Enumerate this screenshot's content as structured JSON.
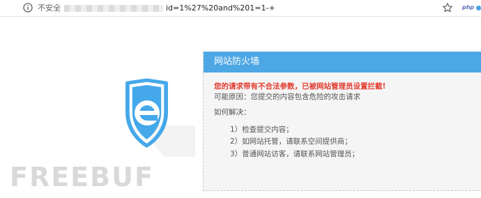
{
  "browser": {
    "security_label": "不安全",
    "url_visible": "id=1%27%20and%201=1-+",
    "extension_label": "php"
  },
  "panel": {
    "title": "网站防火墙",
    "warning": "您的请求带有不合法参数，已被网站管理员设置拦截!",
    "reason": "可能原因：您提交的内容包含危险的攻击请求",
    "howto": "如何解决：",
    "steps": [
      "1）检查提交内容；",
      "2）如网站托管，请联系空间提供商；",
      "3）普通网站访客，请联系网站管理员；"
    ]
  },
  "watermark": {
    "text": "FREEBUF"
  },
  "colors": {
    "header": "#4ea7e5",
    "warning": "#e23b2e",
    "shield": "#45a8ea",
    "panel_bg": "#f5f5f5"
  },
  "icons": [
    "info-icon",
    "star-icon",
    "shield-e-logo"
  ]
}
